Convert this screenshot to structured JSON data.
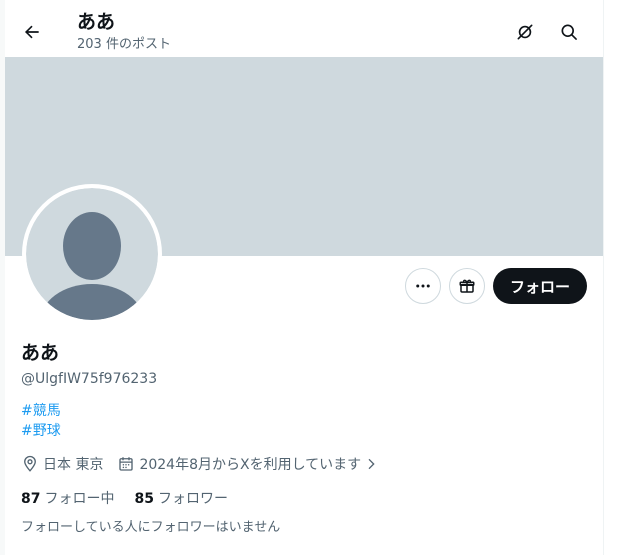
{
  "colors": {
    "banner": "#cfd9de",
    "avatar_bg": "#cfd9de",
    "avatar_silhouette": "#66788a",
    "link": "#1d9bf0",
    "text_primary": "#0f1419",
    "text_secondary": "#536471",
    "follow_button_bg": "#0f1419",
    "follow_button_text": "#ffffff"
  },
  "header": {
    "title": "ああ",
    "post_count": "203 件のポスト",
    "back_icon": "arrow-left-icon",
    "actions": [
      "grok-icon",
      "search-icon"
    ]
  },
  "profile": {
    "display_name": "ああ",
    "handle": "@UlgfIW75f976233",
    "hashtags": [
      "#競馬",
      "#野球"
    ],
    "location": "日本 東京",
    "joined": "2024年8月からXを利用しています",
    "following_count": "87",
    "following_label": "フォロー中",
    "followers_count": "85",
    "followers_label": "フォロワー",
    "followers_you_know": "フォローしている人にフォロワーはいません"
  },
  "actions": {
    "more_icon": "more-icon",
    "subscribe_icon": "gift-icon",
    "follow_label": "フォロー"
  }
}
